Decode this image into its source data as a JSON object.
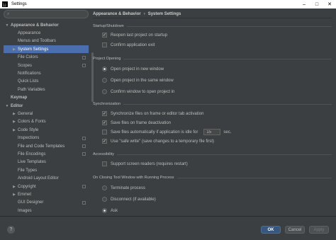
{
  "window": {
    "app_icon_text": "IJ",
    "title": "Settings",
    "minimize": "–",
    "maximize": "□",
    "close": "✕"
  },
  "sidebar": {
    "search_value": "",
    "items": [
      {
        "label": "Appearance & Behavior",
        "arrow": "▼",
        "bold": true
      },
      {
        "label": "Appearance"
      },
      {
        "label": "Menus and Toolbars"
      },
      {
        "label": "System Settings",
        "arrow": "▶",
        "selected": true
      },
      {
        "label": "File Colors",
        "copy": true
      },
      {
        "label": "Scopes",
        "copy": true
      },
      {
        "label": "Notifications"
      },
      {
        "label": "Quick Lists"
      },
      {
        "label": "Path Variables"
      },
      {
        "label": "Keymap",
        "bold": true
      },
      {
        "label": "Editor",
        "arrow": "▼",
        "bold": true
      },
      {
        "label": "General",
        "arrow": "▶"
      },
      {
        "label": "Colors & Fonts",
        "arrow": "▶"
      },
      {
        "label": "Code Style",
        "arrow": "▶"
      },
      {
        "label": "Inspections",
        "copy": true
      },
      {
        "label": "File and Code Templates",
        "copy": true
      },
      {
        "label": "File Encodings",
        "copy": true
      },
      {
        "label": "Live Templates"
      },
      {
        "label": "File Types"
      },
      {
        "label": "Android Layout Editor"
      },
      {
        "label": "Copyright",
        "arrow": "▶",
        "copy": true
      },
      {
        "label": "Emmet",
        "arrow": "▶"
      },
      {
        "label": "GUI Designer",
        "copy": true
      },
      {
        "label": "Images"
      },
      {
        "label": "Intentions"
      }
    ]
  },
  "breadcrumb": {
    "parent": "Appearance & Behavior",
    "separator": "›",
    "current": "System Settings"
  },
  "startup": {
    "title": "Startup/Shutdown",
    "reopen_label": "Reopen last project on startup",
    "reopen_checked": true,
    "confirm_exit_label": "Confirm application exit",
    "confirm_exit_checked": false
  },
  "project_opening": {
    "title": "Project Opening",
    "options": [
      {
        "label": "Open project in new window",
        "selected": true
      },
      {
        "label": "Open project in the same window",
        "selected": false
      },
      {
        "label": "Confirm window to open project in",
        "selected": false
      }
    ]
  },
  "synchronization": {
    "title": "Synchronization",
    "sync_label": "Synchronize files on frame or editor tab activation",
    "sync_checked": true,
    "save_deactivation_label": "Save files on frame deactivation",
    "save_deactivation_checked": true,
    "save_idle_label": "Save files automatically if application is idle for",
    "save_idle_checked": false,
    "idle_value": "15",
    "idle_unit": "sec.",
    "safe_write_label": "Use \"safe write\" (save changes to a temporary file first)",
    "safe_write_checked": true
  },
  "accessibility": {
    "title": "Accessibility",
    "screen_readers_label": "Support screen readers (requires restart)",
    "screen_readers_checked": false
  },
  "closing_tool_window": {
    "title": "On Closing Tool Window with Running Process",
    "options": [
      {
        "label": "Terminate process",
        "selected": false
      },
      {
        "label": "Disconnect (if available)",
        "selected": false
      },
      {
        "label": "Ask",
        "selected": true
      }
    ]
  },
  "footer": {
    "help": "?",
    "ok": "OK",
    "cancel": "Cancel",
    "apply": "Apply"
  },
  "icons": {
    "search": "search-icon",
    "checkmark": "✓"
  }
}
